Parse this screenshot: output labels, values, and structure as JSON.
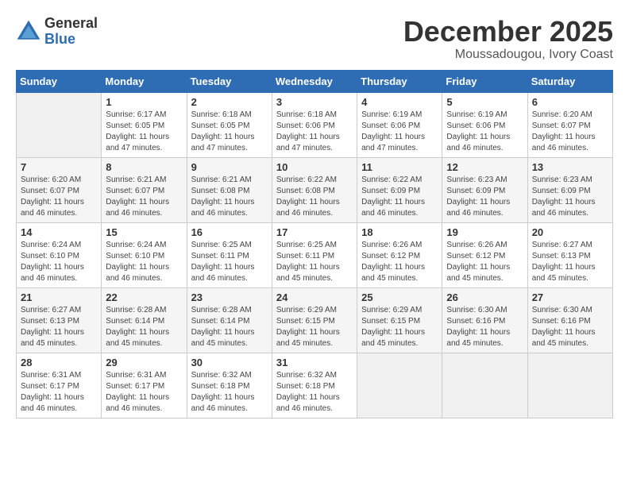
{
  "header": {
    "logo_general": "General",
    "logo_blue": "Blue",
    "month_title": "December 2025",
    "subtitle": "Moussadougou, Ivory Coast"
  },
  "weekdays": [
    "Sunday",
    "Monday",
    "Tuesday",
    "Wednesday",
    "Thursday",
    "Friday",
    "Saturday"
  ],
  "weeks": [
    [
      {
        "day": "",
        "empty": true
      },
      {
        "day": "1",
        "sunrise": "Sunrise: 6:17 AM",
        "sunset": "Sunset: 6:05 PM",
        "daylight": "Daylight: 11 hours and 47 minutes."
      },
      {
        "day": "2",
        "sunrise": "Sunrise: 6:18 AM",
        "sunset": "Sunset: 6:05 PM",
        "daylight": "Daylight: 11 hours and 47 minutes."
      },
      {
        "day": "3",
        "sunrise": "Sunrise: 6:18 AM",
        "sunset": "Sunset: 6:06 PM",
        "daylight": "Daylight: 11 hours and 47 minutes."
      },
      {
        "day": "4",
        "sunrise": "Sunrise: 6:19 AM",
        "sunset": "Sunset: 6:06 PM",
        "daylight": "Daylight: 11 hours and 47 minutes."
      },
      {
        "day": "5",
        "sunrise": "Sunrise: 6:19 AM",
        "sunset": "Sunset: 6:06 PM",
        "daylight": "Daylight: 11 hours and 46 minutes."
      },
      {
        "day": "6",
        "sunrise": "Sunrise: 6:20 AM",
        "sunset": "Sunset: 6:07 PM",
        "daylight": "Daylight: 11 hours and 46 minutes."
      }
    ],
    [
      {
        "day": "7",
        "sunrise": "Sunrise: 6:20 AM",
        "sunset": "Sunset: 6:07 PM",
        "daylight": "Daylight: 11 hours and 46 minutes."
      },
      {
        "day": "8",
        "sunrise": "Sunrise: 6:21 AM",
        "sunset": "Sunset: 6:07 PM",
        "daylight": "Daylight: 11 hours and 46 minutes."
      },
      {
        "day": "9",
        "sunrise": "Sunrise: 6:21 AM",
        "sunset": "Sunset: 6:08 PM",
        "daylight": "Daylight: 11 hours and 46 minutes."
      },
      {
        "day": "10",
        "sunrise": "Sunrise: 6:22 AM",
        "sunset": "Sunset: 6:08 PM",
        "daylight": "Daylight: 11 hours and 46 minutes."
      },
      {
        "day": "11",
        "sunrise": "Sunrise: 6:22 AM",
        "sunset": "Sunset: 6:09 PM",
        "daylight": "Daylight: 11 hours and 46 minutes."
      },
      {
        "day": "12",
        "sunrise": "Sunrise: 6:23 AM",
        "sunset": "Sunset: 6:09 PM",
        "daylight": "Daylight: 11 hours and 46 minutes."
      },
      {
        "day": "13",
        "sunrise": "Sunrise: 6:23 AM",
        "sunset": "Sunset: 6:09 PM",
        "daylight": "Daylight: 11 hours and 46 minutes."
      }
    ],
    [
      {
        "day": "14",
        "sunrise": "Sunrise: 6:24 AM",
        "sunset": "Sunset: 6:10 PM",
        "daylight": "Daylight: 11 hours and 46 minutes."
      },
      {
        "day": "15",
        "sunrise": "Sunrise: 6:24 AM",
        "sunset": "Sunset: 6:10 PM",
        "daylight": "Daylight: 11 hours and 46 minutes."
      },
      {
        "day": "16",
        "sunrise": "Sunrise: 6:25 AM",
        "sunset": "Sunset: 6:11 PM",
        "daylight": "Daylight: 11 hours and 46 minutes."
      },
      {
        "day": "17",
        "sunrise": "Sunrise: 6:25 AM",
        "sunset": "Sunset: 6:11 PM",
        "daylight": "Daylight: 11 hours and 45 minutes."
      },
      {
        "day": "18",
        "sunrise": "Sunrise: 6:26 AM",
        "sunset": "Sunset: 6:12 PM",
        "daylight": "Daylight: 11 hours and 45 minutes."
      },
      {
        "day": "19",
        "sunrise": "Sunrise: 6:26 AM",
        "sunset": "Sunset: 6:12 PM",
        "daylight": "Daylight: 11 hours and 45 minutes."
      },
      {
        "day": "20",
        "sunrise": "Sunrise: 6:27 AM",
        "sunset": "Sunset: 6:13 PM",
        "daylight": "Daylight: 11 hours and 45 minutes."
      }
    ],
    [
      {
        "day": "21",
        "sunrise": "Sunrise: 6:27 AM",
        "sunset": "Sunset: 6:13 PM",
        "daylight": "Daylight: 11 hours and 45 minutes."
      },
      {
        "day": "22",
        "sunrise": "Sunrise: 6:28 AM",
        "sunset": "Sunset: 6:14 PM",
        "daylight": "Daylight: 11 hours and 45 minutes."
      },
      {
        "day": "23",
        "sunrise": "Sunrise: 6:28 AM",
        "sunset": "Sunset: 6:14 PM",
        "daylight": "Daylight: 11 hours and 45 minutes."
      },
      {
        "day": "24",
        "sunrise": "Sunrise: 6:29 AM",
        "sunset": "Sunset: 6:15 PM",
        "daylight": "Daylight: 11 hours and 45 minutes."
      },
      {
        "day": "25",
        "sunrise": "Sunrise: 6:29 AM",
        "sunset": "Sunset: 6:15 PM",
        "daylight": "Daylight: 11 hours and 45 minutes."
      },
      {
        "day": "26",
        "sunrise": "Sunrise: 6:30 AM",
        "sunset": "Sunset: 6:16 PM",
        "daylight": "Daylight: 11 hours and 45 minutes."
      },
      {
        "day": "27",
        "sunrise": "Sunrise: 6:30 AM",
        "sunset": "Sunset: 6:16 PM",
        "daylight": "Daylight: 11 hours and 45 minutes."
      }
    ],
    [
      {
        "day": "28",
        "sunrise": "Sunrise: 6:31 AM",
        "sunset": "Sunset: 6:17 PM",
        "daylight": "Daylight: 11 hours and 46 minutes."
      },
      {
        "day": "29",
        "sunrise": "Sunrise: 6:31 AM",
        "sunset": "Sunset: 6:17 PM",
        "daylight": "Daylight: 11 hours and 46 minutes."
      },
      {
        "day": "30",
        "sunrise": "Sunrise: 6:32 AM",
        "sunset": "Sunset: 6:18 PM",
        "daylight": "Daylight: 11 hours and 46 minutes."
      },
      {
        "day": "31",
        "sunrise": "Sunrise: 6:32 AM",
        "sunset": "Sunset: 6:18 PM",
        "daylight": "Daylight: 11 hours and 46 minutes."
      },
      {
        "day": "",
        "empty": true
      },
      {
        "day": "",
        "empty": true
      },
      {
        "day": "",
        "empty": true
      }
    ]
  ]
}
